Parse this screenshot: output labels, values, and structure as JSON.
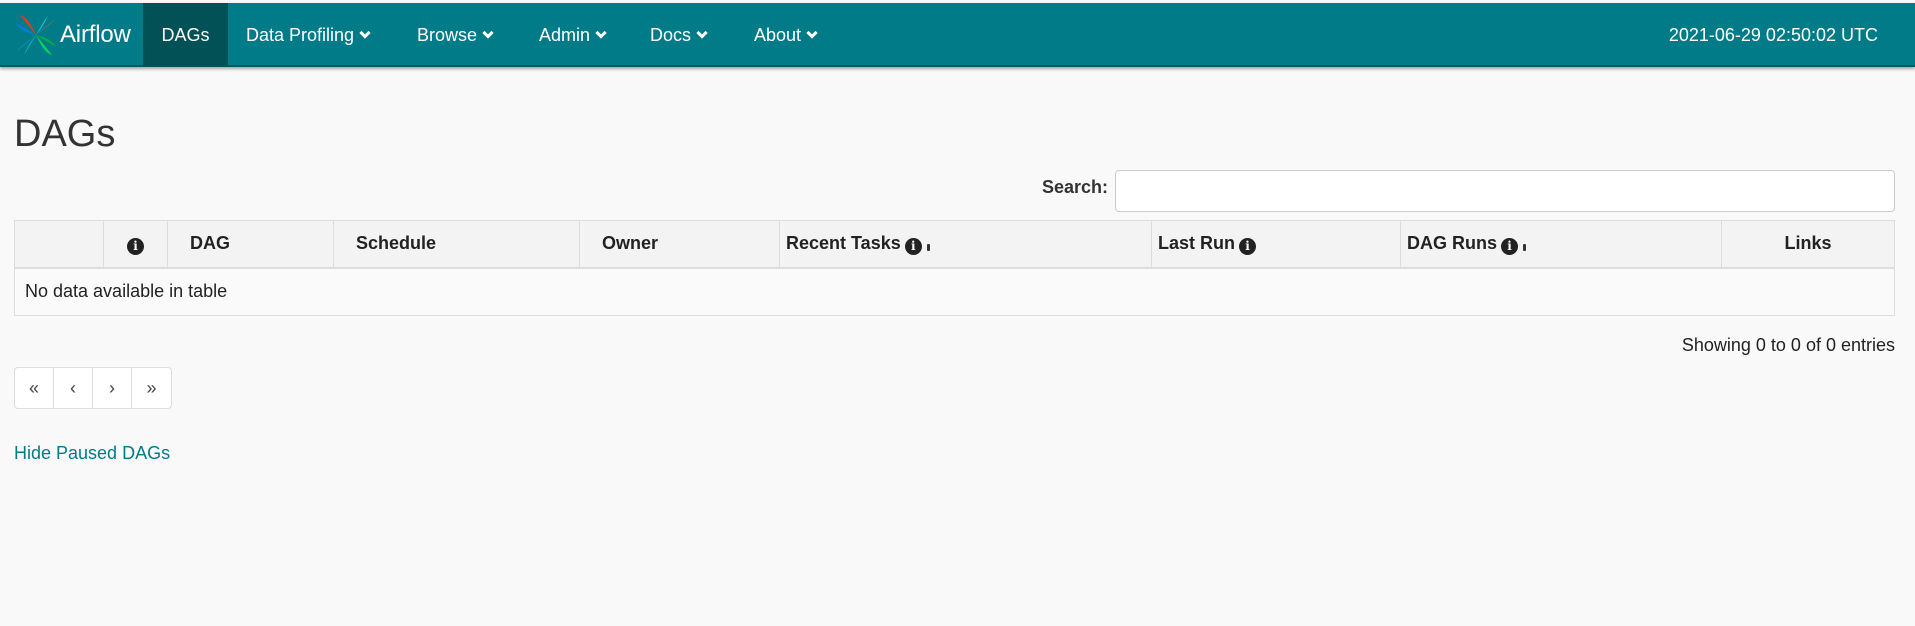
{
  "navbar": {
    "brand": "Airflow",
    "items": [
      {
        "label": "DAGs",
        "active": true,
        "dropdown": false
      },
      {
        "label": "Data Profiling",
        "active": false,
        "dropdown": true
      },
      {
        "label": "Browse",
        "active": false,
        "dropdown": true
      },
      {
        "label": "Admin",
        "active": false,
        "dropdown": true
      },
      {
        "label": "Docs",
        "active": false,
        "dropdown": true
      },
      {
        "label": "About",
        "active": false,
        "dropdown": true
      }
    ],
    "clock": "2021-06-29 02:50:02 UTC",
    "color": "#017b87"
  },
  "page": {
    "title": "DAGs"
  },
  "search": {
    "label": "Search:",
    "value": ""
  },
  "table": {
    "columns": [
      "",
      "",
      "DAG",
      "Schedule",
      "Owner",
      "Recent Tasks",
      "Last Run",
      "DAG Runs",
      "Links"
    ],
    "empty_message": "No data available in table"
  },
  "footer": {
    "showing": "Showing 0 to 0 of 0 entries",
    "pagination": [
      "«",
      "‹",
      "›",
      "»"
    ],
    "hide_paused": "Hide Paused DAGs"
  }
}
